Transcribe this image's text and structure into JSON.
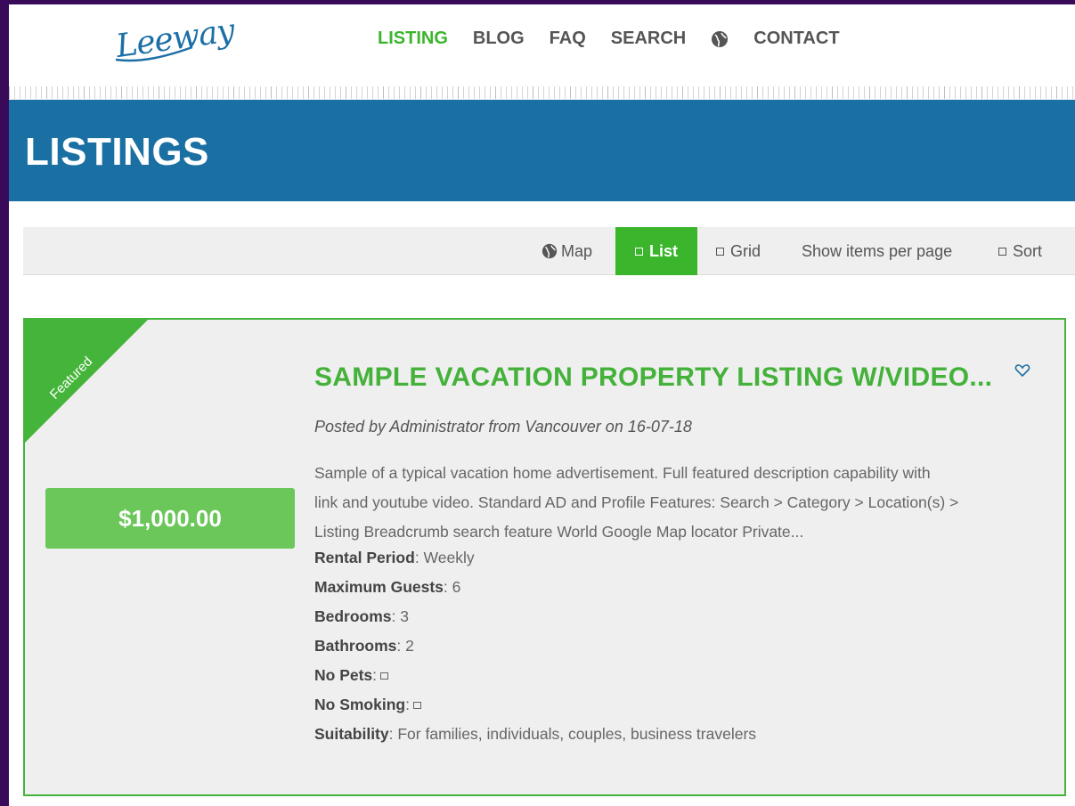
{
  "brand": {
    "logo_text": "Leeway"
  },
  "nav": {
    "items": [
      "LISTING",
      "BLOG",
      "FAQ",
      "SEARCH",
      "CONTACT"
    ],
    "active": "LISTING",
    "globe_icon": "globe-icon"
  },
  "page_title": "LISTINGS",
  "toolbar": {
    "map": "Map",
    "list": "List",
    "grid": "Grid",
    "per_page": "Show items per page",
    "sort": "Sort"
  },
  "listing": {
    "ribbon": "Featured",
    "price": "$1,000.00",
    "title": "SAMPLE VACATION PROPERTY LISTING W/VIDEO...",
    "posted": "Posted by Administrator from Vancouver on 16-07-18",
    "description_lines": [
      "Sample of a typical vacation home advertisement. Full featured description capability with",
      "link and youtube video. Standard AD and Profile Features: Search > Category > Location(s) >",
      "Listing Breadcrumb search feature World Google Map locator  Private..."
    ],
    "specs": {
      "rental_period_label": "Rental Period",
      "rental_period_value": "Weekly",
      "max_guests_label": "Maximum Guests",
      "max_guests_value": "6",
      "bedrooms_label": "Bedrooms",
      "bedrooms_value": "3",
      "bathrooms_label": "Bathrooms",
      "bathrooms_value": "2",
      "no_pets_label": "No Pets",
      "no_smoking_label": "No Smoking",
      "suitability_label": "Suitability",
      "suitability_value": "For families, individuals, couples, business travelers"
    }
  },
  "colors": {
    "accent_green": "#3bb52c",
    "band_blue": "#1a6fa3",
    "outer_purple": "#3a0a5a"
  }
}
